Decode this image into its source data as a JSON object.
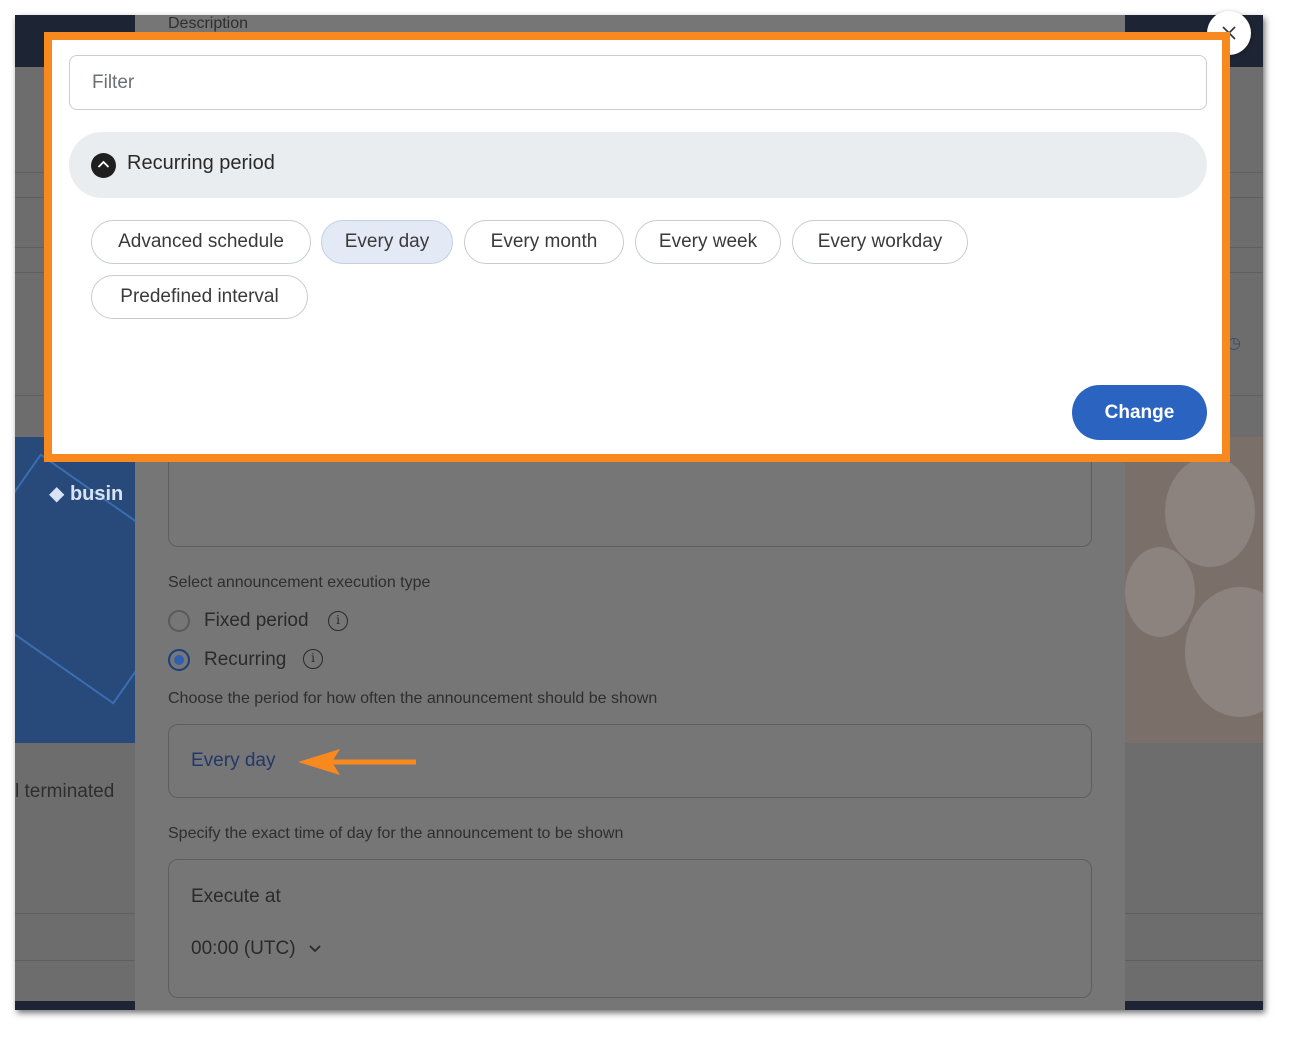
{
  "background": {
    "left_text": "l terminated"
  },
  "dialog": {
    "description_label": "Description",
    "execution_type_label": "Select announcement execution type",
    "option_fixed": "Fixed period",
    "option_recurring": "Recurring",
    "period_label": "Choose the period for how often the announcement should be shown",
    "period_value": "Every day",
    "time_label": "Specify the exact time of day for the announcement to be shown",
    "execute_at_label": "Execute at",
    "execute_at_value": "00:00 (UTC)"
  },
  "popup": {
    "filter_placeholder": "Filter",
    "group_title": "Recurring period",
    "chips": [
      "Advanced schedule",
      "Every day",
      "Every month",
      "Every week",
      "Every workday",
      "Predefined interval"
    ],
    "selected_chip": "Every day",
    "change_label": "Change"
  },
  "colors": {
    "highlight_border": "#f7891e",
    "primary_button": "#2b64c0",
    "selected_chip_bg": "#e3eaf6"
  },
  "icons": {
    "close": "close-icon",
    "accordion": "chevron-up-icon",
    "info": "info-icon",
    "dropdown": "chevron-down-icon",
    "annotation": "arrow-left-icon"
  }
}
